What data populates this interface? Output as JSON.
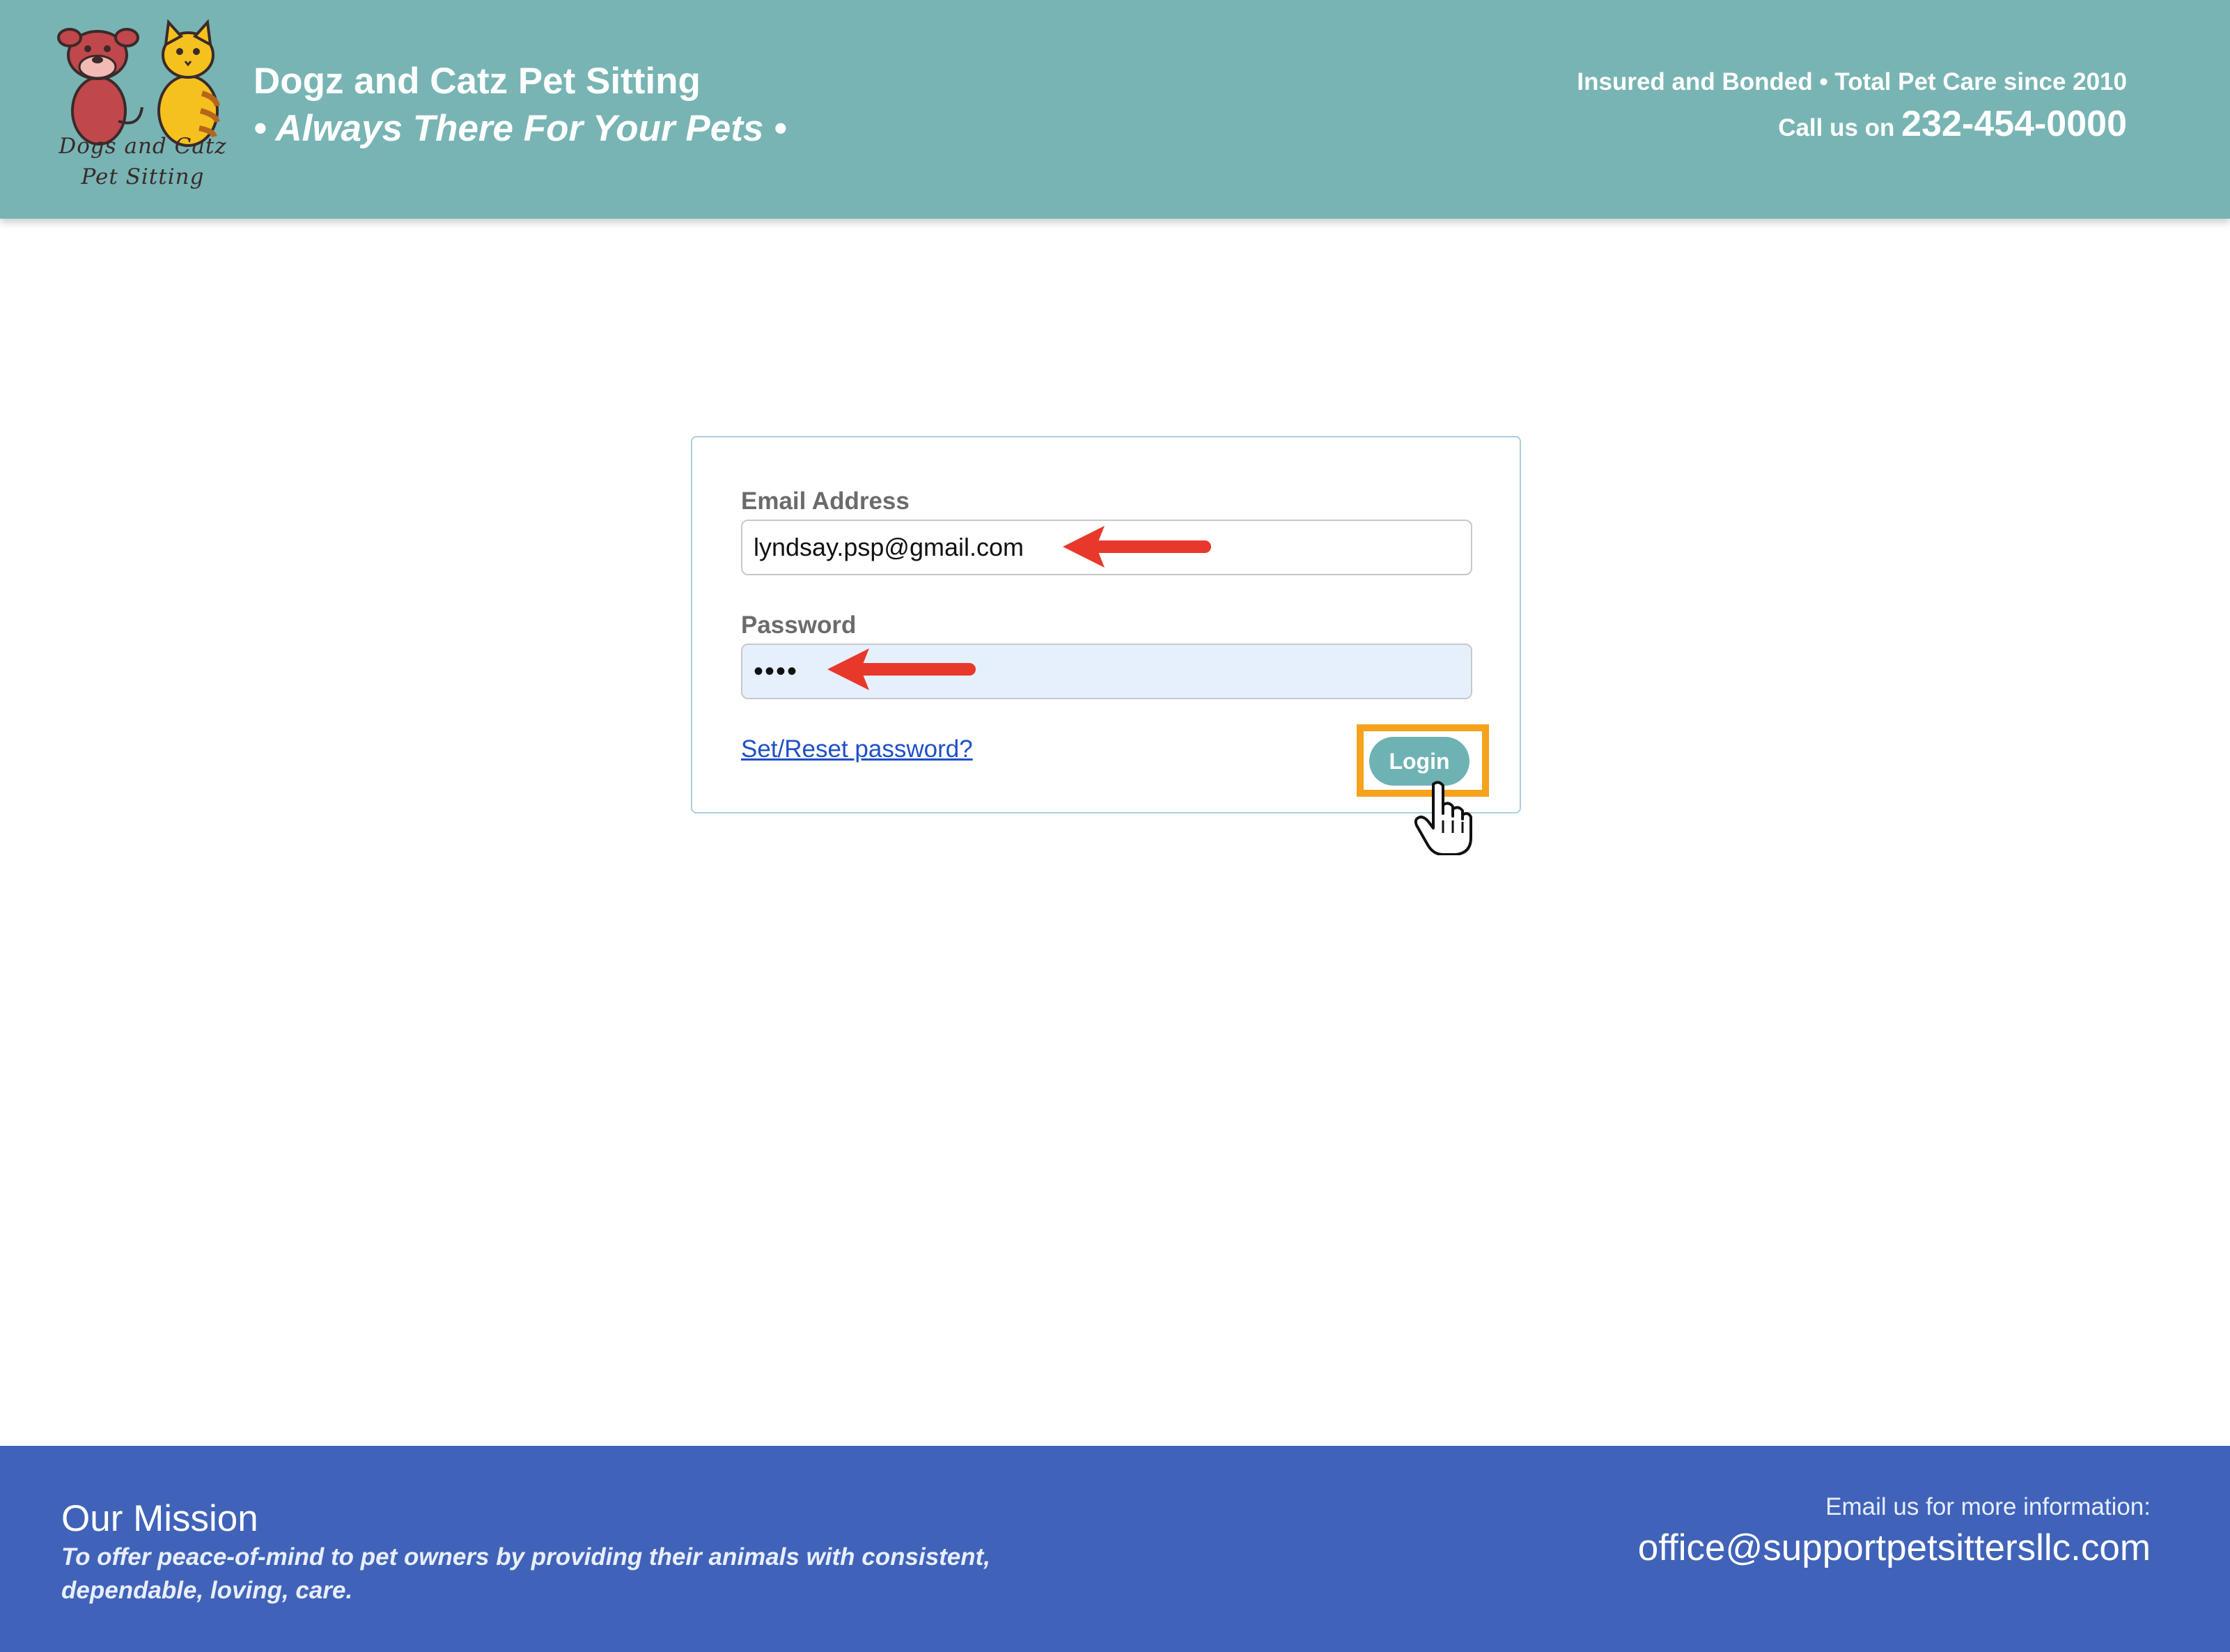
{
  "header": {
    "logo_text_line1": "Dogs and Catz",
    "logo_text_line2": "Pet Sitting",
    "brand_title": "Dogz and Catz Pet Sitting",
    "tagline": "• Always There For Your Pets •",
    "insured_line": "Insured and Bonded • Total Pet Care since 2010",
    "call_prefix": "Call us on ",
    "phone": "232-454-0000"
  },
  "login": {
    "email_label": "Email Address",
    "email_value": "lyndsay.psp@gmail.com",
    "password_label": "Password",
    "password_value": "••••",
    "reset_link": "Set/Reset password?",
    "login_button": "Login"
  },
  "footer": {
    "mission_title": "Our Mission",
    "mission_text": "To offer peace-of-mind to pet owners by providing their animals with consistent, dependable, loving, care.",
    "contact_label": "Email us for more information:",
    "contact_email": "office@supportpetsittersllc.com"
  },
  "colors": {
    "header_bg": "#78b4b4",
    "footer_bg": "#4063b9",
    "button_bg": "#6fb2b3",
    "highlight": "#f6a21c",
    "arrow": "#e8382b",
    "link": "#1f4fc8"
  },
  "icons": [
    "dog-cat-logo",
    "red-arrow-icon",
    "hand-pointer-icon"
  ]
}
